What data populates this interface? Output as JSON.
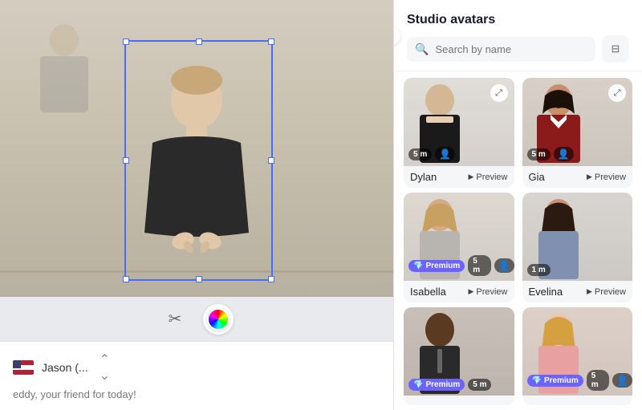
{
  "left": {
    "toolbar": {
      "scissors_label": "✂",
      "colorwheel_label": "color"
    },
    "voice": {
      "name": "Jason (...",
      "flag": "us"
    },
    "script": {
      "preview": "eddy, your friend for today!"
    }
  },
  "right": {
    "title": "Studio avatars",
    "search": {
      "placeholder": "Search by name"
    },
    "avatars": [
      {
        "id": "dylan",
        "name": "Dylan",
        "duration": "5 m",
        "has_user_icon": true,
        "gender": "male",
        "skin": "light",
        "shirt": "black",
        "premium": false
      },
      {
        "id": "gia",
        "name": "Gia",
        "duration": "5 m",
        "has_user_icon": true,
        "gender": "female",
        "skin": "medium",
        "shirt": "red",
        "premium": false
      },
      {
        "id": "isabella",
        "name": "Isabella",
        "duration": "5 m",
        "has_user_icon": true,
        "gender": "female",
        "skin": "light",
        "shirt": "gray",
        "premium": true
      },
      {
        "id": "evelina",
        "name": "Evelina",
        "duration": "1 m",
        "has_user_icon": false,
        "gender": "female",
        "skin": "medium-dark",
        "shirt": "blue",
        "premium": false
      },
      {
        "id": "m1",
        "name": "",
        "duration": "5 m",
        "has_user_icon": false,
        "gender": "male",
        "skin": "dark",
        "shirt": "dark",
        "premium": true
      },
      {
        "id": "f1",
        "name": "",
        "duration": "5 m",
        "has_user_icon": true,
        "gender": "female",
        "skin": "light",
        "shirt": "pink",
        "premium": true
      }
    ],
    "preview_label": "Preview",
    "premium_label": "Premium"
  }
}
